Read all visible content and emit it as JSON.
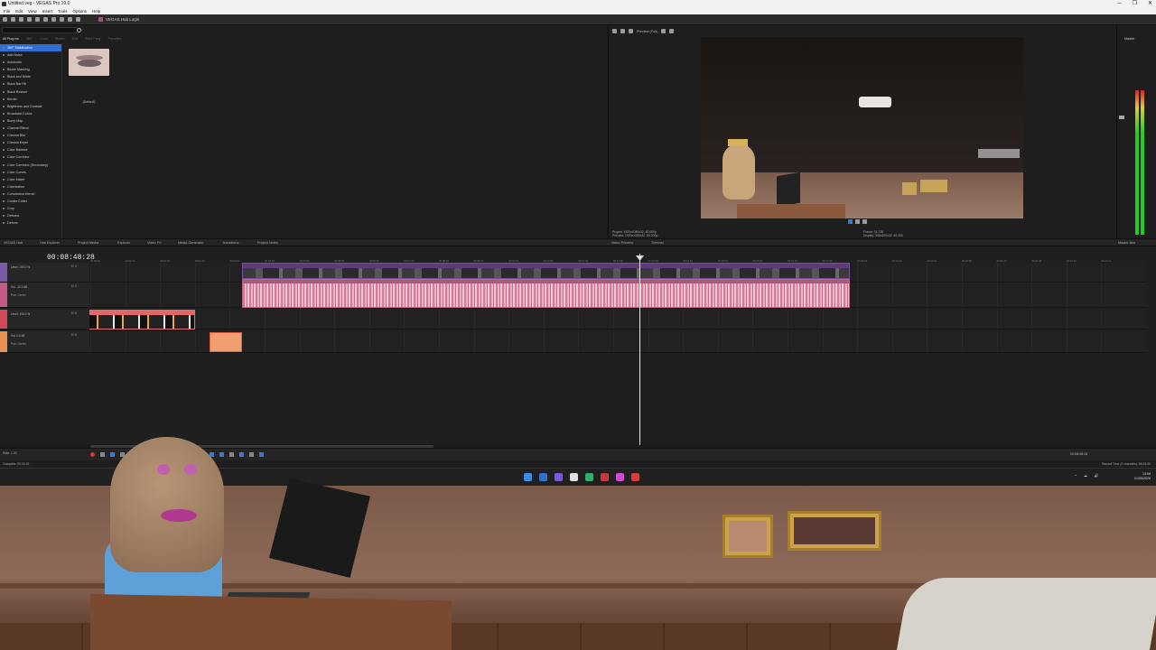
{
  "window": {
    "title": "Untitled.veg - VEGAS Pro 19.0",
    "controls": [
      "─",
      "❐",
      "✕"
    ]
  },
  "menu": [
    "File",
    "Edit",
    "View",
    "Insert",
    "Tools",
    "Options",
    "Help"
  ],
  "toolbar": {
    "login_label": "VEGAS Hub Login"
  },
  "plugins": {
    "tabs": [
      "All Plug-ins",
      "360°",
      "Color",
      "Stylize",
      "Blur",
      "Third Party",
      "Favorites"
    ],
    "items": [
      "360° Stabilization",
      "Add Noise",
      "Autolooks",
      "Bezier Masking",
      "Black and White",
      "Black Bar Fill",
      "Black Restore",
      "Border",
      "Brightness and Contrast",
      "Broadcast Colors",
      "Bump Map",
      "Channel Blend",
      "Chroma Blur",
      "Chroma Keyer",
      "Color Balance",
      "Color Corrector",
      "Color Corrector (Secondary)",
      "Color Curves",
      "Color Match",
      "Colorization",
      "Convolution Kernel",
      "Cookie Cutter",
      "Crop",
      "Defocus",
      "Deform"
    ],
    "preset_label": "(Default)",
    "description_line1": "VEGAS 360° Stabilization: OFX, 32-bit floating point, GPU Accelerated, Grouping VEGAS360, Version 1.0",
    "description_line2": "Description: From Magix Computer Products Intl. Co."
  },
  "preview": {
    "mode": "Preview (Full)",
    "info_left_line1": "Project: 1920x1080x32, 60.000p",
    "info_left_line2": "Preview: 1920x1080x32, 60.000p",
    "info_right_line1": "Frame: 31,738",
    "info_right_line2": "Display: 356x200x32, 60.000"
  },
  "master": {
    "label": "Master"
  },
  "panel_tabs": [
    "VEGAS Hub",
    "Hub Explorer",
    "Project Media",
    "Explorer",
    "Video FX",
    "Media Generator",
    "Transitions",
    "Project Notes"
  ],
  "preview_tabs": [
    "Video Preview",
    "Trimmer"
  ],
  "master_tab": "Master Bus",
  "timeline": {
    "timecode": "00:08:48:28",
    "ruler_marks": [
      "00:00:00",
      "00:00:50",
      "00:01:40",
      "00:02:30",
      "00:03:20",
      "00:04:10",
      "00:05:00",
      "00:05:50",
      "00:06:40",
      "00:07:30",
      "00:08:20",
      "00:09:10",
      "00:10:00",
      "00:10:50",
      "00:11:40",
      "00:12:30",
      "00:13:20",
      "00:14:10",
      "00:15:00",
      "00:15:50",
      "00:16:40",
      "00:17:30",
      "00:18:20",
      "00:19:10",
      "00:20:00",
      "00:20:50",
      "00:21:40",
      "00:22:30",
      "00:23:20",
      "00:24:10"
    ],
    "tracks": [
      {
        "num": "1",
        "color": "#7b5aa6",
        "name": "Level: 100.0 %",
        "pan": "",
        "ms": "M  S"
      },
      {
        "num": "2",
        "color": "#c45a86",
        "name": "Vol: -12.0 dB",
        "pan": "Pan: Center",
        "ms": "M  S"
      },
      {
        "num": "3",
        "color": "#d04a5a",
        "name": "Level: 100.0 %",
        "pan": "",
        "ms": "M  S"
      },
      {
        "num": "4",
        "color": "#e89050",
        "name": "Vol: 0.0 dB",
        "pan": "Pan: Center",
        "ms": "M  S"
      }
    ]
  },
  "transport": {
    "rate": "Rate: 1.00",
    "timecode": "00:08:48:28"
  },
  "status": {
    "left": "Complete: 00:00:01",
    "right": "Record Time (2 channels): 86:04:00"
  },
  "taskbar": {
    "icon_colors": [
      "#3a8ee6",
      "#2f6fd1",
      "#7a5ad6",
      "#e0e0e0",
      "#2fae6a",
      "#c43a3a",
      "#d04ad0",
      "#d93a3a"
    ],
    "tray": [
      "^",
      "☁",
      "🔊"
    ],
    "time": "13:58",
    "date": "01/05/2026"
  }
}
